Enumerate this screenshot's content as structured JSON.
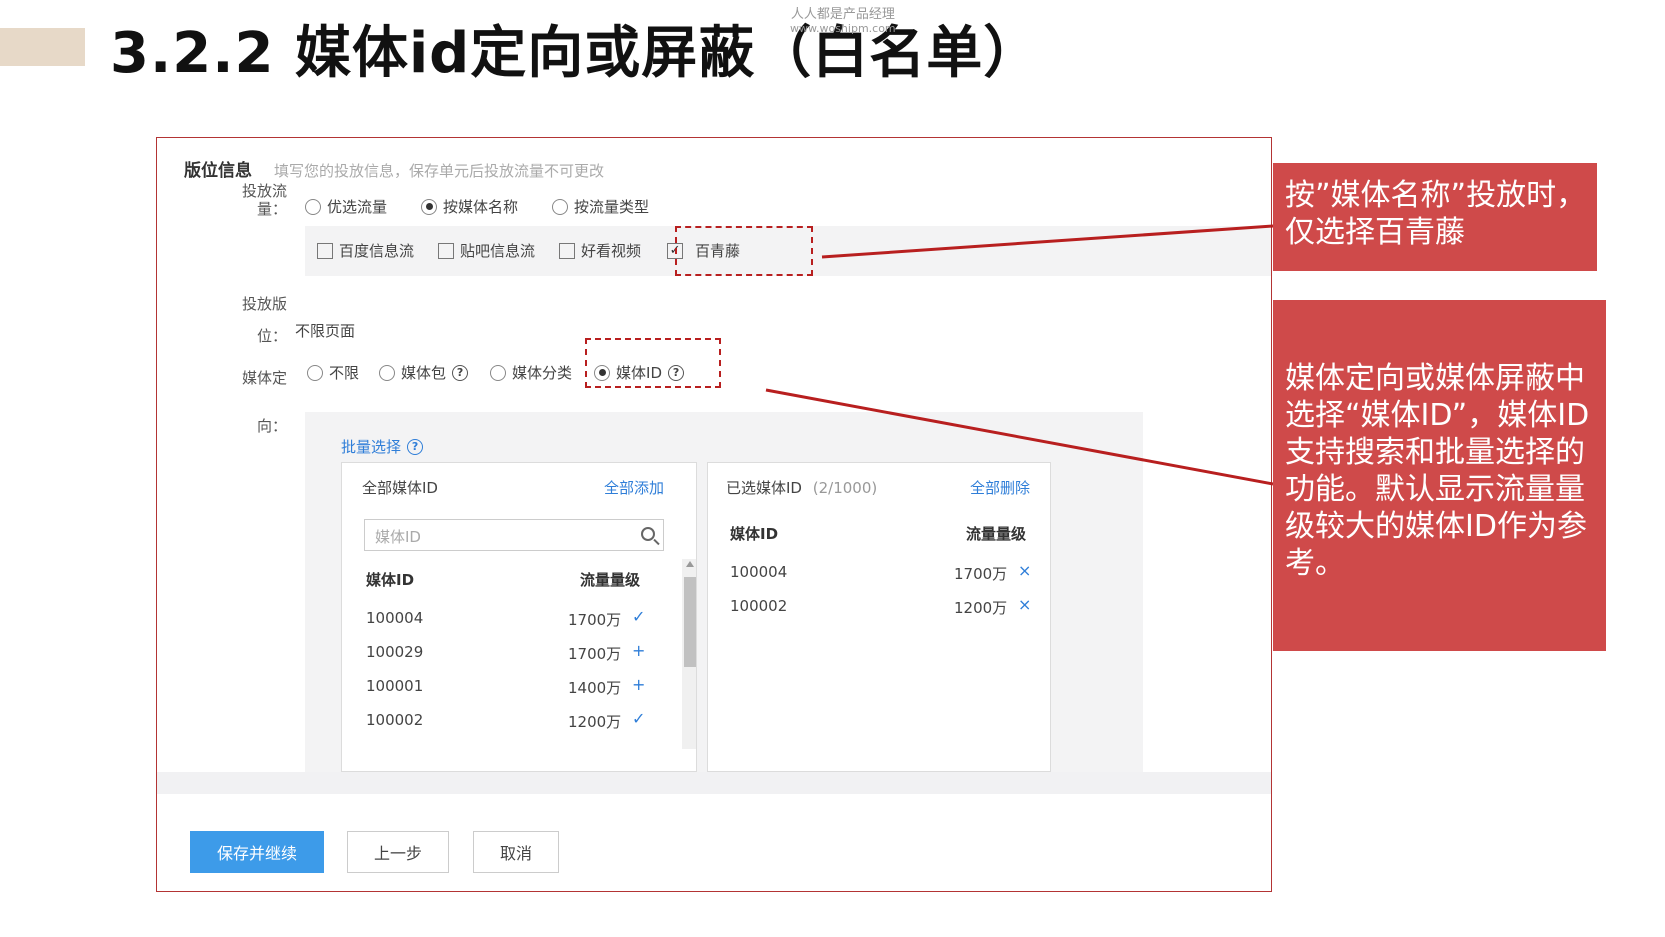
{
  "slide": {
    "title": "3.2.2 媒体id定向或屏蔽（白名单）",
    "watermark_line1": "人人都是产品经理",
    "watermark_line2": "www.woshipm.com"
  },
  "panel": {
    "header_title": "版位信息",
    "header_hint": "填写您的投放信息，保存单元后投放流量不可更改",
    "traffic_label": "投放流量：",
    "traffic_options": [
      "优选流量",
      "按媒体名称",
      "按流量类型"
    ],
    "traffic_selected": 1,
    "media_names": [
      "百度信息流",
      "贴吧信息流",
      "好看视频",
      "百青藤"
    ],
    "media_checked": [
      false,
      false,
      false,
      true
    ],
    "placement_label": "投放版位：",
    "placement_value": "不限页面",
    "targeting_label": "媒体定向：",
    "targeting_options": [
      "不限",
      "媒体包",
      "媒体分类",
      "媒体ID"
    ],
    "targeting_selected": 3,
    "batch_select": "批量选择"
  },
  "all_media": {
    "title": "全部媒体ID",
    "add_all": "全部添加",
    "search_placeholder": "媒体ID",
    "col_id": "媒体ID",
    "col_traffic": "流量量级",
    "rows": [
      {
        "id": "100004",
        "traffic": "1700万",
        "mark": "✓"
      },
      {
        "id": "100029",
        "traffic": "1700万",
        "mark": "+"
      },
      {
        "id": "100001",
        "traffic": "1400万",
        "mark": "+"
      },
      {
        "id": "100002",
        "traffic": "1200万",
        "mark": "✓"
      }
    ]
  },
  "selected_media": {
    "title": "已选媒体ID",
    "count": "(2/1000)",
    "delete_all": "全部删除",
    "col_id": "媒体ID",
    "col_traffic": "流量量级",
    "rows": [
      {
        "id": "100004",
        "traffic": "1700万",
        "mark": "×"
      },
      {
        "id": "100002",
        "traffic": "1200万",
        "mark": "×"
      }
    ]
  },
  "buttons": {
    "save_continue": "保存并继续",
    "prev_step": "上一步",
    "cancel": "取消"
  },
  "callouts": {
    "top": "按”媒体名称”投放时，仅选择百青藤",
    "bottom": "媒体定向或媒体屏蔽中选择“媒体ID”，媒体ID支持搜索和批量选择的功能。默认显示流量量级较大的媒体ID作为参考。"
  },
  "colors": {
    "accent_red": "#cf4a4a",
    "dash_red": "#b81f1f",
    "link_blue": "#2f7ed8",
    "primary_button": "#3d9be9",
    "title_accent_bar": "#e7d9c8"
  }
}
